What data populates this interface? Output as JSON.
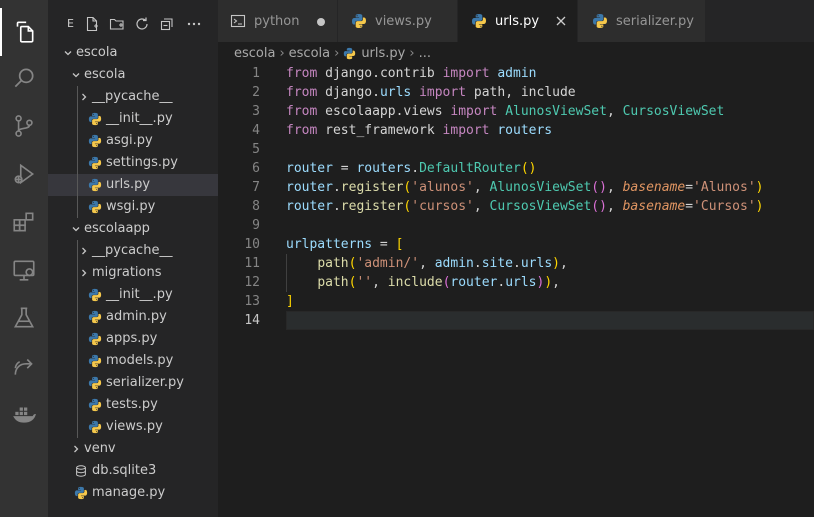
{
  "explorer": {
    "header_initial": "E",
    "tree": [
      {
        "label": "escola",
        "kind": "folder",
        "open": true
      },
      {
        "label": "escola",
        "kind": "folder",
        "open": true
      },
      {
        "label": "__pycache__",
        "kind": "folder",
        "open": false
      },
      {
        "label": "__init__.py",
        "kind": "python"
      },
      {
        "label": "asgi.py",
        "kind": "python"
      },
      {
        "label": "settings.py",
        "kind": "python"
      },
      {
        "label": "urls.py",
        "kind": "python",
        "selected": true
      },
      {
        "label": "wsgi.py",
        "kind": "python"
      },
      {
        "label": "escolaapp",
        "kind": "folder",
        "open": true
      },
      {
        "label": "__pycache__",
        "kind": "folder",
        "open": false
      },
      {
        "label": "migrations",
        "kind": "folder",
        "open": false
      },
      {
        "label": "__init__.py",
        "kind": "python"
      },
      {
        "label": "admin.py",
        "kind": "python"
      },
      {
        "label": "apps.py",
        "kind": "python"
      },
      {
        "label": "models.py",
        "kind": "python"
      },
      {
        "label": "serializer.py",
        "kind": "python"
      },
      {
        "label": "tests.py",
        "kind": "python"
      },
      {
        "label": "views.py",
        "kind": "python"
      },
      {
        "label": "venv",
        "kind": "folder",
        "open": false
      },
      {
        "label": "db.sqlite3",
        "kind": "database"
      },
      {
        "label": "manage.py",
        "kind": "python"
      }
    ]
  },
  "tabs": [
    {
      "label": "python",
      "icon": "terminal-icon",
      "modified": true,
      "active": false
    },
    {
      "label": "views.py",
      "icon": "python-icon",
      "active": false
    },
    {
      "label": "urls.py",
      "icon": "python-icon",
      "active": true
    },
    {
      "label": "serializer.py",
      "icon": "python-icon",
      "active": false
    }
  ],
  "breadcrumb": {
    "parts": [
      "escola",
      "escola",
      "urls.py",
      "..."
    ]
  },
  "editor": {
    "current_line": 14,
    "line_numbers": [
      "1",
      "2",
      "3",
      "4",
      "5",
      "6",
      "7",
      "8",
      "9",
      "10",
      "11",
      "12",
      "13",
      "14"
    ],
    "lines": [
      "from django.contrib import admin",
      "from django.urls import path, include",
      "from escolaapp.views import AlunosViewSet, CursosViewSet",
      "from rest_framework import routers",
      "",
      "router = routers.DefaultRouter()",
      "router.register('alunos', AlunosViewSet(), basename='Alunos')",
      "router.register('cursos', CursosViewSet(), basename='Cursos')",
      "",
      "urlpatterns = [",
      "    path('admin/', admin.site.urls),",
      "    path('', include(router.urls)),",
      "]",
      ""
    ]
  },
  "colors": {
    "keyword": "#c586c0",
    "class": "#4ec9b0",
    "function": "#dcdcaa",
    "variable": "#9cdcfe",
    "string": "#ce9178",
    "parameter": "#e09562",
    "python_icon_blue": "#3c78aa",
    "python_icon_yellow": "#f5c84c"
  }
}
